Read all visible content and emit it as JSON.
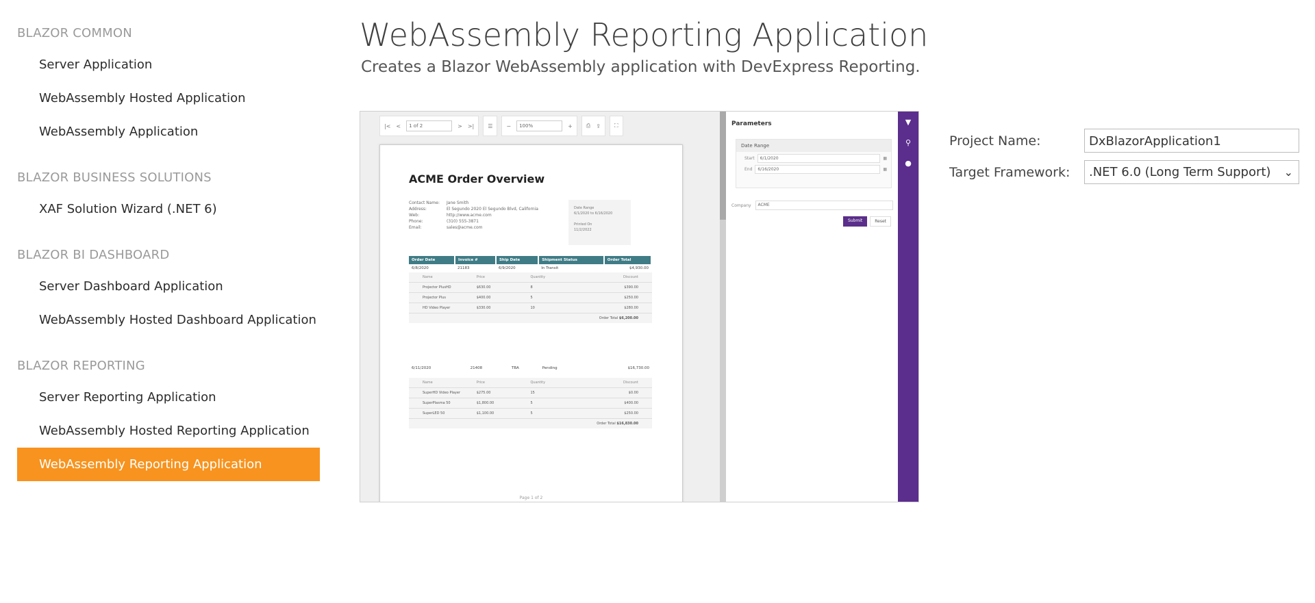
{
  "sidebar": {
    "groups": [
      {
        "header": "BLAZOR COMMON",
        "items": [
          "Server Application",
          "WebAssembly Hosted Application",
          "WebAssembly Application"
        ]
      },
      {
        "header": "BLAZOR BUSINESS SOLUTIONS",
        "items": [
          "XAF Solution Wizard (.NET 6)"
        ]
      },
      {
        "header": "BLAZOR BI DASHBOARD",
        "items": [
          "Server Dashboard Application",
          "WebAssembly Hosted Dashboard Application"
        ]
      },
      {
        "header": "BLAZOR REPORTING",
        "items": [
          "Server Reporting Application",
          "WebAssembly Hosted Reporting Application",
          "WebAssembly Reporting Application"
        ]
      }
    ],
    "selected": "WebAssembly Reporting Application"
  },
  "main": {
    "title": "WebAssembly Reporting Application",
    "subtitle": "Creates a Blazor WebAssembly application with DevExpress Reporting."
  },
  "preview": {
    "page_input": "1 of 2",
    "zoom": "100%",
    "report_title": "ACME Order Overview",
    "contact": [
      {
        "label": "Contact Name:",
        "value": "Jane Smith"
      },
      {
        "label": "Address:",
        "value": "El Segundo 2020 El Segundo Blvd, California"
      },
      {
        "label": "Web:",
        "value": "http://www.acme.com"
      },
      {
        "label": "Phone:",
        "value": "(310) 555-3871"
      },
      {
        "label": "Email:",
        "value": "sales@acme.com"
      }
    ],
    "date_range_label": "Date Range",
    "date_range_value": "6/1/2020 to 6/16/2020",
    "printed_label": "Printed On",
    "printed_value": "11/2/2022",
    "columns": [
      "Order Date",
      "Invoice #",
      "Ship Date",
      "Shipment Status",
      "Order Total"
    ],
    "orders": [
      {
        "date": "6/8/2020",
        "invoice": "21183",
        "ship": "6/9/2020",
        "status": "In Transit",
        "total": "$4,930.00",
        "detail": [
          [
            "Projector PlusHD",
            "$630.00",
            "8",
            "$390.00"
          ],
          [
            "Projector Plus",
            "$400.00",
            "5",
            "$250.00"
          ],
          [
            "HD Video Player",
            "$330.00",
            "10",
            "$280.00"
          ]
        ],
        "order_total": "$6,200.00"
      },
      {
        "date": "6/11/2020",
        "invoice": "21408",
        "ship": "TBA",
        "status": "Pending",
        "total": "$16,730.00",
        "detail": [
          [
            "SuperHD Video Player",
            "$275.00",
            "15",
            "$0.00"
          ],
          [
            "SuperPlasma 50",
            "$1,800.00",
            "5",
            "$400.00"
          ],
          [
            "SuperLED 50",
            "$1,100.00",
            "5",
            "$250.00"
          ]
        ],
        "order_total": "$16,830.00"
      }
    ],
    "detail_headers": [
      "Name",
      "Price",
      "Quantity",
      "Discount"
    ],
    "order_total_label": "Order Total",
    "page_footer": "Page 1 of 2",
    "params": {
      "title": "Parameters",
      "date_range": "Date Range",
      "start_label": "Start",
      "start_value": "6/1/2020",
      "end_label": "End",
      "end_value": "6/16/2020",
      "company_label": "Company",
      "company_value": "ACME",
      "submit": "Submit",
      "reset": "Reset"
    }
  },
  "form": {
    "project_name_label": "Project Name:",
    "project_name_value": "DxBlazorApplication1",
    "framework_label": "Target Framework:",
    "framework_value": ".NET 6.0 (Long Term Support)"
  }
}
